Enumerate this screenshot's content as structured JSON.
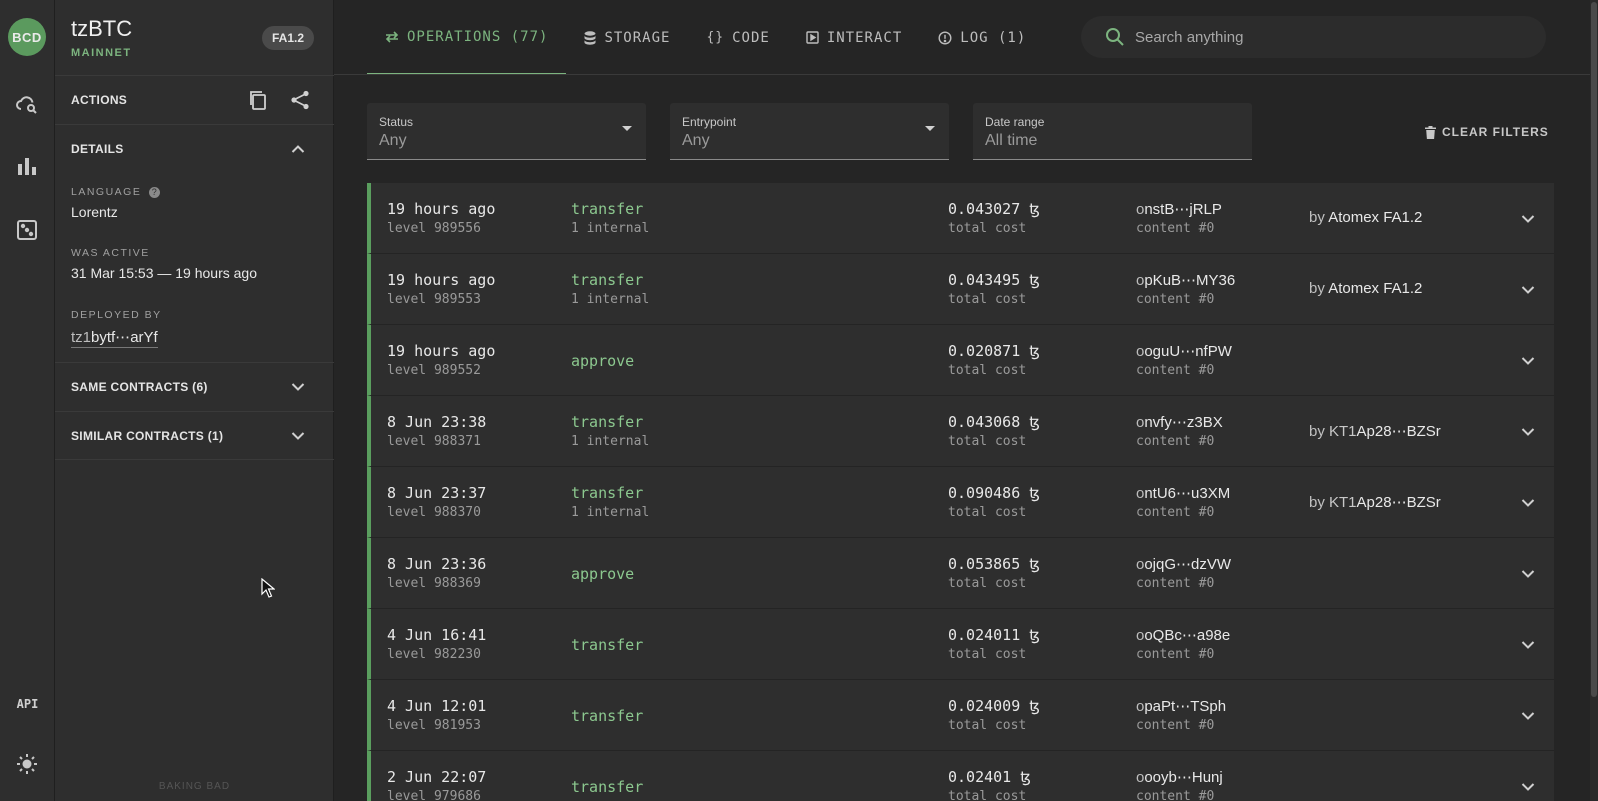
{
  "app": {
    "logo": "BCD",
    "footer": "BAKING BAD",
    "api_label": "API"
  },
  "contract": {
    "name": "tzBTC",
    "network": "MAINNET",
    "standard_badge": "FA1.2"
  },
  "side": {
    "actions_label": "ACTIONS",
    "details_label": "DETAILS",
    "language_label": "LANGUAGE",
    "language_value": "Lorentz",
    "was_active_label": "WAS ACTIVE",
    "was_active_value": "31 Mar 15:53 — 19 hours ago",
    "deployed_by_label": "DEPLOYED BY",
    "deployed_by_prefix": "tz1",
    "deployed_by_value": "bytf⋯arYf",
    "same_contracts": "SAME CONTRACTS (6)",
    "similar_contracts": "SIMILAR CONTRACTS (1)"
  },
  "tabs": [
    {
      "label": "OPERATIONS (77)",
      "icon": "swap-icon",
      "active": true
    },
    {
      "label": "STORAGE",
      "icon": "database-icon",
      "active": false
    },
    {
      "label": "CODE",
      "icon": "braces-icon",
      "active": false
    },
    {
      "label": "INTERACT",
      "icon": "play-box-icon",
      "active": false
    },
    {
      "label": "LOG (1)",
      "icon": "alert-circle-icon",
      "active": false
    }
  ],
  "search": {
    "placeholder": "Search anything"
  },
  "filters": {
    "status": {
      "label": "Status",
      "value": "Any"
    },
    "entrypoint": {
      "label": "Entrypoint",
      "value": "Any"
    },
    "date_range": {
      "label": "Date range",
      "value": "All time"
    },
    "clear_label": "CLEAR FILTERS"
  },
  "operations": [
    {
      "time": "19 hours ago",
      "level": "level 989556",
      "entrypoint": "transfer",
      "internal": "1 internal",
      "cost": "0.043027 ꜩ",
      "cost_label": "total cost",
      "hash_prefix": "o",
      "hash": "nstB⋯jRLP",
      "content": "content #0",
      "by_label": "by",
      "by_prefix": "",
      "by": "Atomex FA1.2"
    },
    {
      "time": "19 hours ago",
      "level": "level 989553",
      "entrypoint": "transfer",
      "internal": "1 internal",
      "cost": "0.043495 ꜩ",
      "cost_label": "total cost",
      "hash_prefix": "o",
      "hash": "pKuB⋯MY36",
      "content": "content #0",
      "by_label": "by",
      "by_prefix": "",
      "by": "Atomex FA1.2"
    },
    {
      "time": "19 hours ago",
      "level": "level 989552",
      "entrypoint": "approve",
      "internal": "",
      "cost": "0.020871 ꜩ",
      "cost_label": "total cost",
      "hash_prefix": "o",
      "hash": "oguU⋯nfPW",
      "content": "content #0",
      "by_label": "",
      "by_prefix": "",
      "by": ""
    },
    {
      "time": "8 Jun 23:38",
      "level": "level 988371",
      "entrypoint": "transfer",
      "internal": "1 internal",
      "cost": "0.043068 ꜩ",
      "cost_label": "total cost",
      "hash_prefix": "o",
      "hash": "nvfy⋯z3BX",
      "content": "content #0",
      "by_label": "by",
      "by_prefix": "KT1",
      "by": "Ap28⋯BZSr"
    },
    {
      "time": "8 Jun 23:37",
      "level": "level 988370",
      "entrypoint": "transfer",
      "internal": "1 internal",
      "cost": "0.090486 ꜩ",
      "cost_label": "total cost",
      "hash_prefix": "o",
      "hash": "ntU6⋯u3XM",
      "content": "content #0",
      "by_label": "by",
      "by_prefix": "KT1",
      "by": "Ap28⋯BZSr"
    },
    {
      "time": "8 Jun 23:36",
      "level": "level 988369",
      "entrypoint": "approve",
      "internal": "",
      "cost": "0.053865 ꜩ",
      "cost_label": "total cost",
      "hash_prefix": "o",
      "hash": "ojqG⋯dzVW",
      "content": "content #0",
      "by_label": "",
      "by_prefix": "",
      "by": ""
    },
    {
      "time": "4 Jun 16:41",
      "level": "level 982230",
      "entrypoint": "transfer",
      "internal": "",
      "cost": "0.024011 ꜩ",
      "cost_label": "total cost",
      "hash_prefix": "o",
      "hash": "oQBc⋯a98e",
      "content": "content #0",
      "by_label": "",
      "by_prefix": "",
      "by": ""
    },
    {
      "time": "4 Jun 12:01",
      "level": "level 981953",
      "entrypoint": "transfer",
      "internal": "",
      "cost": "0.024009 ꜩ",
      "cost_label": "total cost",
      "hash_prefix": "o",
      "hash": "paPt⋯TSph",
      "content": "content #0",
      "by_label": "",
      "by_prefix": "",
      "by": ""
    },
    {
      "time": "2 Jun 22:07",
      "level": "level 979686",
      "entrypoint": "transfer",
      "internal": "",
      "cost": "0.02401 ꜩ",
      "cost_label": "total cost",
      "hash_prefix": "o",
      "hash": "ooyb⋯Hunj",
      "content": "content #0",
      "by_label": "",
      "by_prefix": "",
      "by": ""
    }
  ],
  "colors": {
    "accent": "#7cb47f",
    "background": "#252525",
    "panel": "#2e2e2e",
    "row_marker": "#5a9e5e"
  }
}
